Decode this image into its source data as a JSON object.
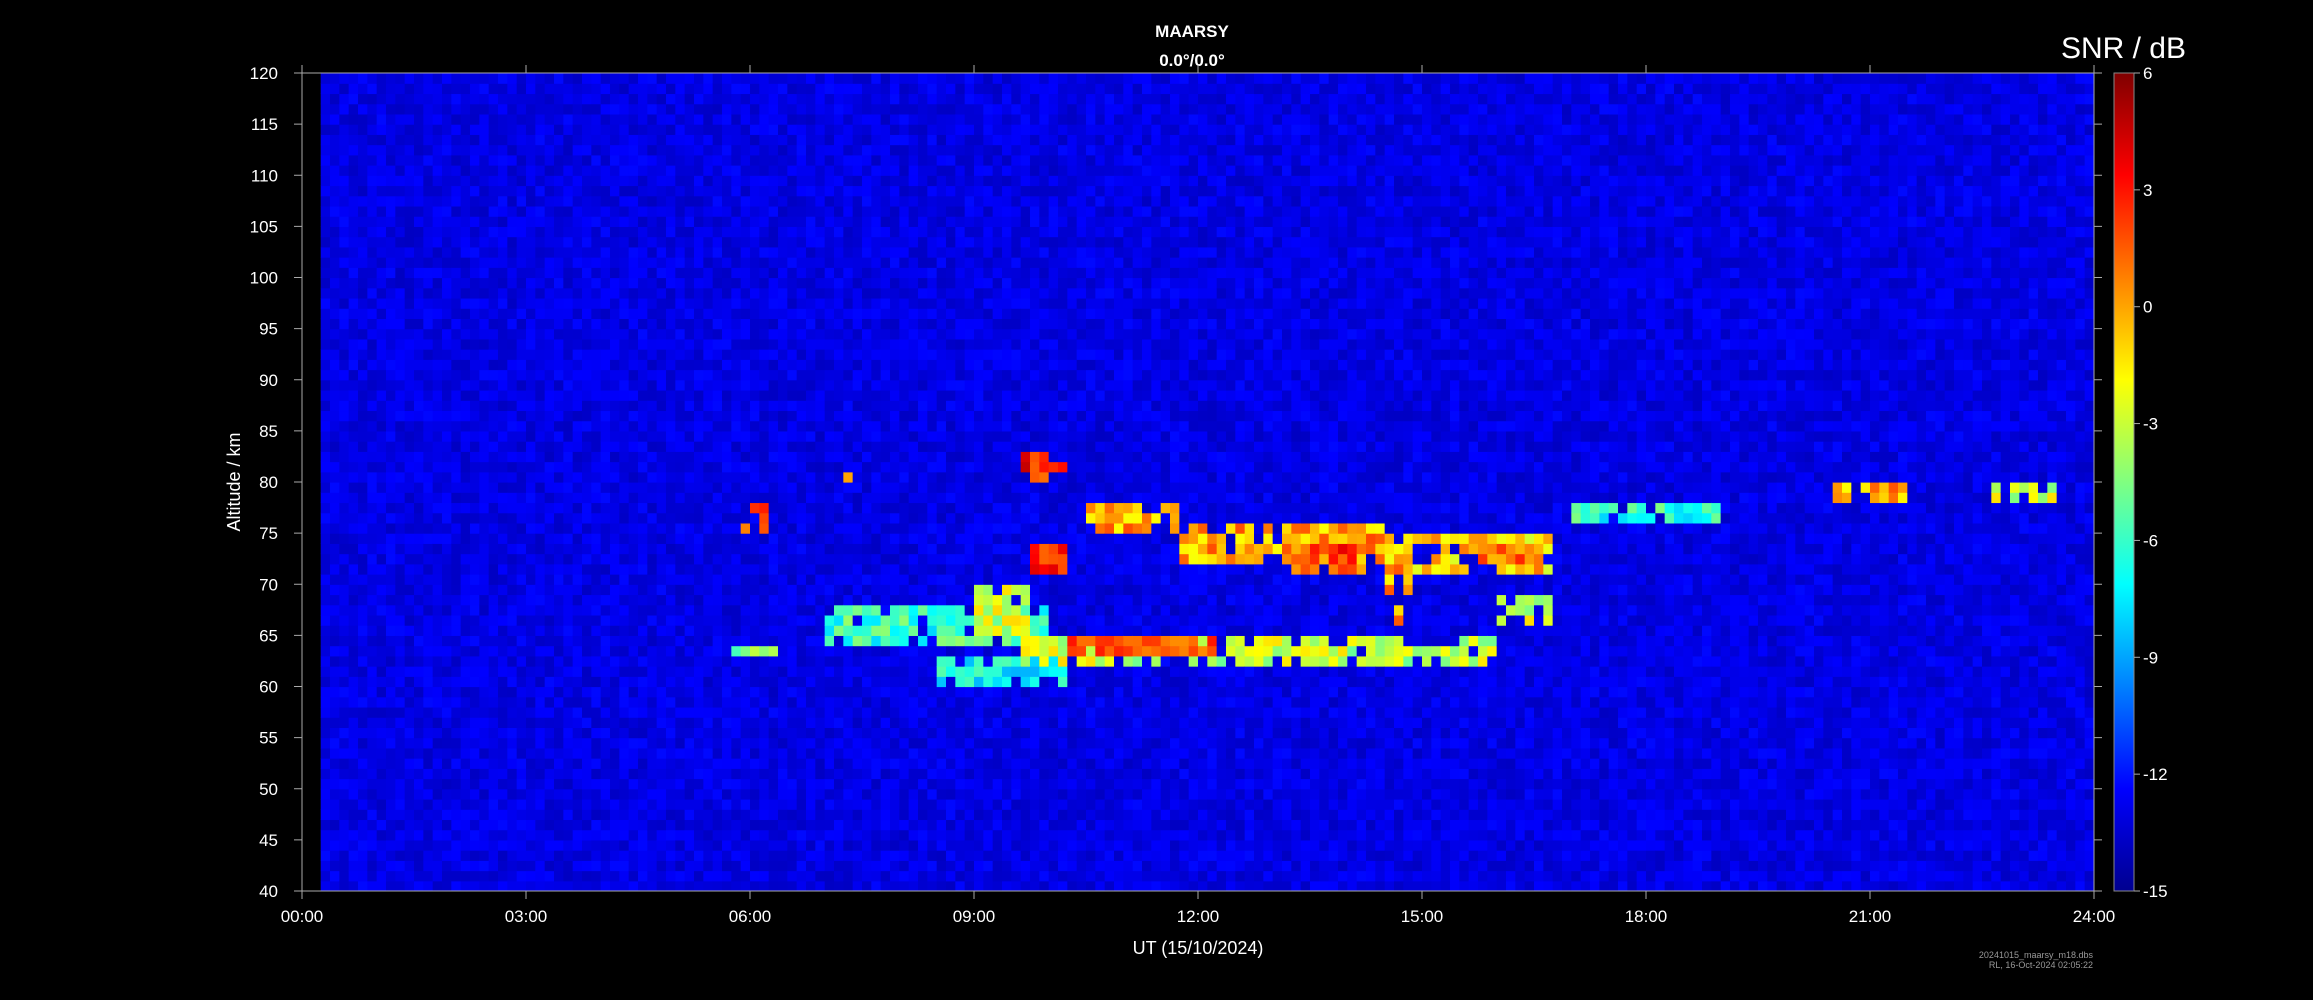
{
  "chart_data": {
    "type": "heatmap",
    "title": "MAARSY",
    "subtitle": "0.0°/0.0°",
    "xlabel": "UT (15/10/2024)",
    "ylabel": "Altitude / km",
    "x_ticks": [
      "00:00",
      "03:00",
      "06:00",
      "09:00",
      "12:00",
      "15:00",
      "18:00",
      "21:00",
      "24:00"
    ],
    "xlim_hours": [
      0,
      24
    ],
    "ylim_km": [
      40,
      120
    ],
    "y_ticks": [
      40,
      45,
      50,
      55,
      60,
      65,
      70,
      75,
      80,
      85,
      90,
      95,
      100,
      105,
      110,
      115,
      120
    ],
    "colorbar": {
      "label": "SNR / dB",
      "range": [
        -15,
        6
      ],
      "ticks": [
        6,
        3,
        0,
        -3,
        -6,
        -9,
        -12,
        -15
      ],
      "colormap": "jet",
      "stops": [
        "#00008f",
        "#0000ff",
        "#0080ff",
        "#00ffff",
        "#80ff80",
        "#ffff00",
        "#ff8000",
        "#ff0000",
        "#800000"
      ]
    },
    "background_snr_db": -13,
    "data_start_hours": 0.25,
    "data_end_hours": 24.0,
    "echo_regions": [
      {
        "t_start": 10.5,
        "t_end": 11.7,
        "alt_low": 75,
        "alt_high": 78,
        "snr_db": 0
      },
      {
        "t_start": 11.7,
        "t_end": 14.5,
        "alt_low": 72,
        "alt_high": 75.5,
        "snr_db": 0
      },
      {
        "t_start": 14.5,
        "t_end": 16.8,
        "alt_low": 71.5,
        "alt_high": 75,
        "snr_db": -1
      },
      {
        "t_start": 13.2,
        "t_end": 14.3,
        "alt_low": 71,
        "alt_high": 73.5,
        "snr_db": 2
      },
      {
        "t_start": 14.5,
        "t_end": 14.9,
        "alt_low": 69.5,
        "alt_high": 73,
        "snr_db": 0
      },
      {
        "t_start": 15.7,
        "t_end": 16.5,
        "alt_low": 72,
        "alt_high": 74,
        "snr_db": 1
      },
      {
        "t_start": 9.6,
        "t_end": 16.0,
        "alt_low": 62.5,
        "alt_high": 65,
        "snr_db": -3
      },
      {
        "t_start": 10.2,
        "t_end": 12.3,
        "alt_low": 63,
        "alt_high": 65,
        "snr_db": 1
      },
      {
        "t_start": 7.0,
        "t_end": 10.0,
        "alt_low": 64,
        "alt_high": 68,
        "snr_db": -6
      },
      {
        "t_start": 9.0,
        "t_end": 9.8,
        "alt_low": 65,
        "alt_high": 70,
        "snr_db": -3
      },
      {
        "t_start": 8.5,
        "t_end": 10.2,
        "alt_low": 60.5,
        "alt_high": 62.5,
        "snr_db": -7
      },
      {
        "t_start": 9.6,
        "t_end": 10.3,
        "alt_low": 80.5,
        "alt_high": 82.5,
        "snr_db": 3
      },
      {
        "t_start": 9.8,
        "t_end": 10.2,
        "alt_low": 71.5,
        "alt_high": 73.5,
        "snr_db": 3
      },
      {
        "t_start": 5.9,
        "t_end": 6.3,
        "alt_low": 75.5,
        "alt_high": 77.5,
        "snr_db": 1
      },
      {
        "t_start": 7.2,
        "t_end": 7.4,
        "alt_low": 80.3,
        "alt_high": 81.3,
        "snr_db": -1
      },
      {
        "t_start": 5.8,
        "t_end": 6.4,
        "alt_low": 62.8,
        "alt_high": 64.2,
        "snr_db": -5
      },
      {
        "t_start": 14.6,
        "t_end": 14.8,
        "alt_low": 65.5,
        "alt_high": 68,
        "snr_db": 0
      },
      {
        "t_start": 16.0,
        "t_end": 16.8,
        "alt_low": 66.5,
        "alt_high": 68.5,
        "snr_db": -3
      },
      {
        "t_start": 17.0,
        "t_end": 19.0,
        "alt_low": 76,
        "alt_high": 78,
        "snr_db": -6
      },
      {
        "t_start": 20.5,
        "t_end": 21.5,
        "alt_low": 78.5,
        "alt_high": 80,
        "snr_db": 0
      },
      {
        "t_start": 22.5,
        "t_end": 23.5,
        "alt_low": 78,
        "alt_high": 79.5,
        "snr_db": -3
      }
    ]
  },
  "footer": {
    "filename": "20241015_maarsy_m18.dbs",
    "credit": "RL, 16-Oct-2024 02:05:22"
  }
}
